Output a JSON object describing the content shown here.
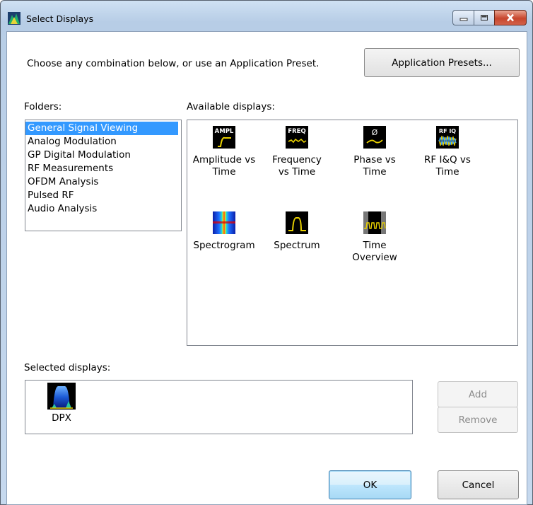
{
  "window": {
    "title": "Select Displays",
    "controls": [
      "minimize-icon",
      "maximize-icon",
      "close-icon"
    ]
  },
  "header": {
    "prompt": "Choose any combination below, or use an Application Preset.",
    "presets_button": "Application Presets..."
  },
  "folders": {
    "label": "Folders:",
    "items": [
      {
        "label": "General Signal Viewing",
        "selected": true
      },
      {
        "label": "Analog Modulation",
        "selected": false
      },
      {
        "label": "GP Digital Modulation",
        "selected": false
      },
      {
        "label": "RF Measurements",
        "selected": false
      },
      {
        "label": "OFDM Analysis",
        "selected": false
      },
      {
        "label": "Pulsed RF",
        "selected": false
      },
      {
        "label": "Audio Analysis",
        "selected": false
      }
    ]
  },
  "available": {
    "label": "Available displays:",
    "items": [
      {
        "line1": "Amplitude vs",
        "line2": "Time",
        "icon_text": "AMPL",
        "icon": "amplitude-icon"
      },
      {
        "line1": "Frequency",
        "line2": "vs Time",
        "icon_text": "FREQ",
        "icon": "frequency-icon"
      },
      {
        "line1": "Phase vs",
        "line2": "Time",
        "icon_text": "Ø",
        "icon": "phase-icon"
      },
      {
        "line1": "RF I&Q vs",
        "line2": "Time",
        "icon_text": "RF IQ",
        "icon": "rf-iq-icon"
      },
      {
        "line1": "Spectrogram",
        "line2": "",
        "icon_text": "",
        "icon": "spectrogram-icon"
      },
      {
        "line1": "Spectrum",
        "line2": "",
        "icon_text": "",
        "icon": "spectrum-icon"
      },
      {
        "line1": "Time",
        "line2": "Overview",
        "icon_text": "",
        "icon": "time-overview-icon"
      }
    ]
  },
  "selected": {
    "label": "Selected displays:",
    "items": [
      {
        "label": "DPX",
        "icon": "dpx-icon"
      }
    ]
  },
  "buttons": {
    "add": "Add",
    "remove": "Remove",
    "ok": "OK",
    "cancel": "Cancel"
  },
  "colors": {
    "selection": "#3399ff",
    "icon_trace": "#e8d000",
    "close_button": "#c7462d"
  }
}
